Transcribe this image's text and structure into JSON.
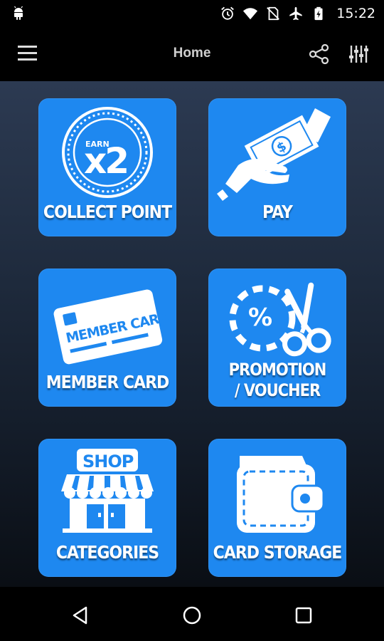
{
  "status_bar": {
    "time": "15:22",
    "icons": [
      "android-icon",
      "alarm-icon",
      "wifi-icon",
      "no-sim-icon",
      "airplane-icon",
      "battery-charging-icon"
    ]
  },
  "app_bar": {
    "title": "Home",
    "icons": [
      "menu-icon",
      "share-icon",
      "filter-icon"
    ]
  },
  "tiles": [
    {
      "label": "COLLECT POINT",
      "icon": "earn-x2-badge-icon",
      "badge_small": "EARN",
      "badge_big": "x2"
    },
    {
      "label": "PAY",
      "icon": "hand-money-icon"
    },
    {
      "label": "MEMBER CARD",
      "icon": "member-card-icon",
      "card_text": "MEMBER CARD"
    },
    {
      "label_line1": "PROMOTION",
      "label_line2": "/ VOUCHER",
      "icon": "coupon-scissors-icon",
      "coupon_symbol": "%"
    },
    {
      "label": "CATEGORIES",
      "icon": "shop-icon",
      "sign_text": "SHOP"
    },
    {
      "label": "CARD STORAGE",
      "icon": "wallet-icon"
    }
  ],
  "nav_bar": {
    "icons": [
      "back-icon",
      "home-icon",
      "recent-apps-icon"
    ]
  },
  "colors": {
    "tile": "#1e88f0",
    "background_top": "#2c3a52",
    "background_bottom": "#0a0e14"
  }
}
